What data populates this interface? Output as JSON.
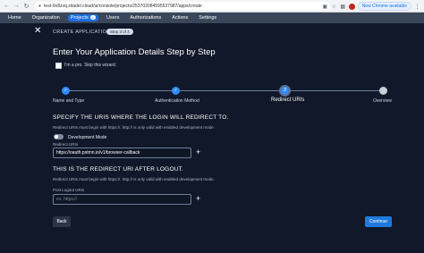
{
  "browser": {
    "url": "test-0o8zvq.zitadel.cloud/ui/console/projects/253702084595537987/apps/create",
    "update_label": "New Chrome available"
  },
  "app_nav": {
    "items": [
      {
        "label": "Home"
      },
      {
        "label": "Organization"
      },
      {
        "label": "Projects",
        "badge": "1",
        "active": true
      },
      {
        "label": "Users"
      },
      {
        "label": "Authorizations"
      },
      {
        "label": "Actions"
      },
      {
        "label": "Settings"
      }
    ]
  },
  "header": {
    "title": "CREATE APPLICATION",
    "step_pill": "Step 3 of 4"
  },
  "main_heading": "Enter Your Application Details Step by Step",
  "pro_checkbox_label": "I'm a pro. Skip this wizard.",
  "stepper": {
    "steps": [
      {
        "label": "Name and Type",
        "status": "done",
        "icon": "check-icon"
      },
      {
        "label": "Authentication Method",
        "status": "done",
        "icon": "check-icon"
      },
      {
        "label": "Redirect URIs",
        "status": "current",
        "number": "3"
      },
      {
        "label": "Overview",
        "status": "pending"
      }
    ]
  },
  "redirect_section": {
    "heading": "SPECIFY THE URIS WHERE THE LOGIN WILL REDIRECT TO.",
    "hint": "Redirect URIs must begin with https://. http:// is only valid with enabled development mode.",
    "toggle_label": "Development Mode",
    "field_label": "Redirect URIs",
    "value": "https://oauth.pstmn.io/v1/browser-callback"
  },
  "logout_section": {
    "heading": "THIS IS THE REDIRECT URI AFTER LOGOUT.",
    "hint": "Redirect URIs must begin with https://. http:// is only valid with enabled development mode.",
    "field_label": "Post Logout URIs",
    "placeholder": "ex. https://"
  },
  "footer": {
    "back_label": "Back",
    "continue_label": "Continue"
  },
  "colors": {
    "background": "#101829",
    "nav_bar": "#3a475a",
    "accent": "#1f7ae0"
  }
}
